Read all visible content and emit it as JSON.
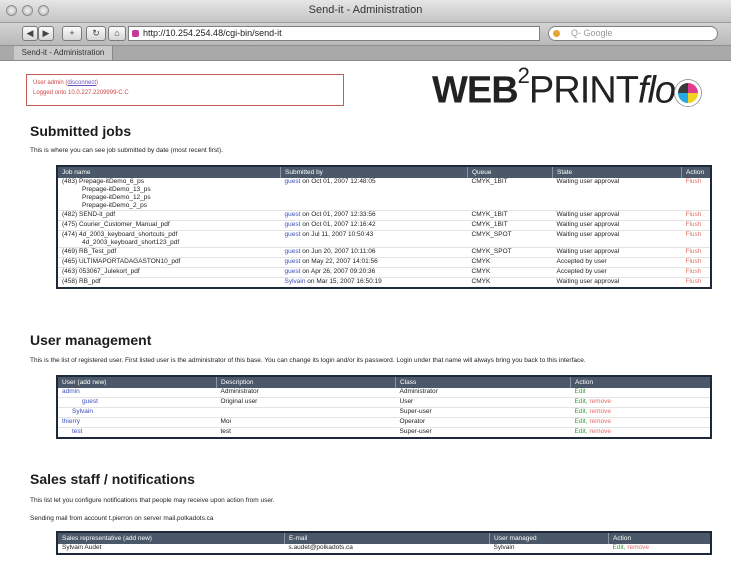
{
  "browser": {
    "window_title": "Send-it - Administration",
    "url": "http://10.254.254.48/cgi-bin/send-it",
    "search_placeholder": "Q- Google",
    "tab_label": "Send-it - Administration"
  },
  "login": {
    "line1_prefix": "User admin",
    "disconnect_label": "disconnect",
    "line2": "Logged onto 10.0.227.2209999-C.C"
  },
  "logo": {
    "part1": "WEB",
    "sup": "2",
    "part2": "PRINT",
    "part3": "flo"
  },
  "jobs": {
    "heading": "Submitted jobs",
    "description": "This is where you can see job submitted by date (most recent first).",
    "columns": [
      "Job name",
      "Submitted by",
      "Queue",
      "State",
      "Action"
    ],
    "rows": [
      {
        "name": "(483) Prepage-itDemo_6_ps",
        "files": [
          "Prepage-itDemo_13_ps",
          "Prepage-itDemo_12_ps",
          "Prepage-itDemo_2_ps"
        ],
        "user": "guest",
        "date": "on Oct 01, 2007 12:48:05",
        "queue": "CMYK_1BIT",
        "state": "Waiting user approval",
        "action": "Flush"
      },
      {
        "name": "(482) SEND-it_pdf",
        "files": [],
        "user": "guest",
        "date": "on Oct 01, 2007 12:33:56",
        "queue": "CMYK_1BIT",
        "state": "Waiting user approval",
        "action": "Flush"
      },
      {
        "name": "(475) Courier_Customer_Manual_pdf",
        "files": [],
        "user": "guest",
        "date": "on Oct 01, 2007 12:16:42",
        "queue": "CMYK_1BIT",
        "state": "Waiting user approval",
        "action": "Flush"
      },
      {
        "name": "(474) 4d_2003_keyboard_shortcuts_pdf",
        "files": [
          "4d_2003_keyboard_short123_pdf"
        ],
        "user": "guest",
        "date": "on Jul 11, 2007 10:50:43",
        "queue": "CMYK_SPOT",
        "state": "Waiting user approval",
        "action": "Flush"
      },
      {
        "name": "(469) RB_Test_pdf",
        "files": [],
        "user": "guest",
        "date": "on Jun 20, 2007 10:11:06",
        "queue": "CMYK_SPOT",
        "state": "Waiting user approval",
        "action": "Flush"
      },
      {
        "name": "(465) ULTIMAPORTADAGASTON10_pdf",
        "files": [],
        "user": "guest",
        "date": "on May 22, 2007 14:01:56",
        "queue": "CMYK",
        "state": "Accepted by user",
        "action": "Flush"
      },
      {
        "name": "(463) 053067_Julekort_pdf",
        "files": [],
        "user": "guest",
        "date": "on Apr 26, 2007 09:20:36",
        "queue": "CMYK",
        "state": "Accepted by user",
        "action": "Flush"
      },
      {
        "name": "(458) RB_pdf",
        "files": [],
        "user": "Sylvain",
        "date": "on Mar 15, 2007 16:50:19",
        "queue": "CMYK",
        "state": "Waiting user approval",
        "action": "Flush"
      }
    ]
  },
  "users": {
    "heading": "User management",
    "description": "This is the list of registered user. First listed user is the administrator of this base. You can change its login and/or its password. Login under that name will always bring you back to this interface.",
    "columns": [
      "User (add new)",
      "Description",
      "Class",
      "Action"
    ],
    "rows": [
      {
        "user": "admin",
        "indent": 0,
        "description": "Administrator",
        "class": "Administrator",
        "edit": "Edit",
        "remove": ""
      },
      {
        "user": "guest",
        "indent": 2,
        "description": "Original user",
        "class": "User",
        "edit": "Edit,",
        "remove": "remove"
      },
      {
        "user": "Sylvain",
        "indent": 1,
        "description": "",
        "class": "Super-user",
        "edit": "Edit,",
        "remove": "remove"
      },
      {
        "user": "thierry",
        "indent": 0,
        "description": "Moi",
        "class": "Operator",
        "edit": "Edit,",
        "remove": "remove"
      },
      {
        "user": "test",
        "indent": 1,
        "description": "test",
        "class": "Super-user",
        "edit": "Edit,",
        "remove": "remove"
      }
    ]
  },
  "sales": {
    "heading": "Sales staff / notifications",
    "description": "This list let you configure notifications that people may receive upon action from user.",
    "mail_line": "Sending mail from account t.pierron on server mail.polkadots.ca",
    "columns": [
      "Sales representative (add new)",
      "E-mail",
      "User managed",
      "Action"
    ],
    "rows": [
      {
        "name": "Sylvain Audet",
        "email": "s.audet@polkadots.ca",
        "user": "Sylvain",
        "edit": "Edit,",
        "remove": "remove"
      }
    ]
  }
}
